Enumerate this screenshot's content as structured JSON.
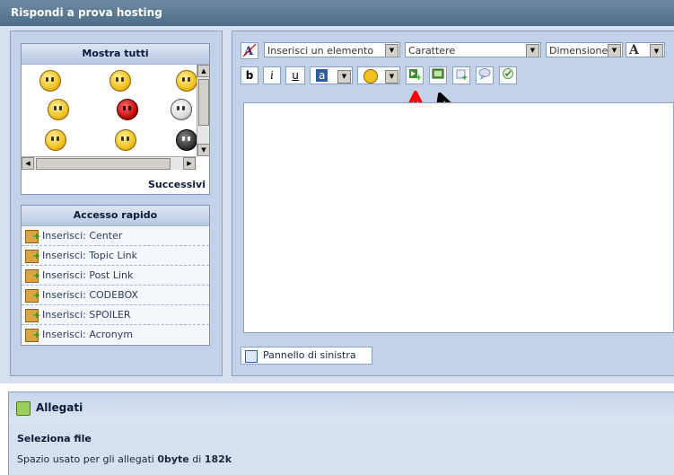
{
  "title": "Rispondi a prova hosting",
  "emoticons": {
    "header": "Mostra tutti",
    "next": "Successivi"
  },
  "quick_access": {
    "header": "Accesso rapido",
    "items": [
      {
        "label": "Inserisci: Center"
      },
      {
        "label": "Inserisci: Topic Link"
      },
      {
        "label": "Inserisci: Post Link"
      },
      {
        "label": "Inserisci: CODEBOX"
      },
      {
        "label": "Inserisci: SPOILER"
      },
      {
        "label": "Inserisci: Acronym"
      }
    ]
  },
  "toolbar": {
    "insert_element": "Inserisci un elemento",
    "font": "Carattere",
    "size": "Dimensione",
    "font_color_glyph": "A",
    "bold": "b",
    "italic": "i",
    "underline": "u",
    "highlight_glyph": "a"
  },
  "left_panel_button": "Pannello di sinistra",
  "attachments": {
    "title": "Allegati",
    "select_file": "Seleziona file",
    "space_prefix": "Spazio usato per gli allegati",
    "used": "0byte",
    "of": "di",
    "total": "182k"
  },
  "colors": {
    "red_arrow": "#ff0000",
    "black_arrow": "#000000",
    "accent": "#4d6c86"
  }
}
